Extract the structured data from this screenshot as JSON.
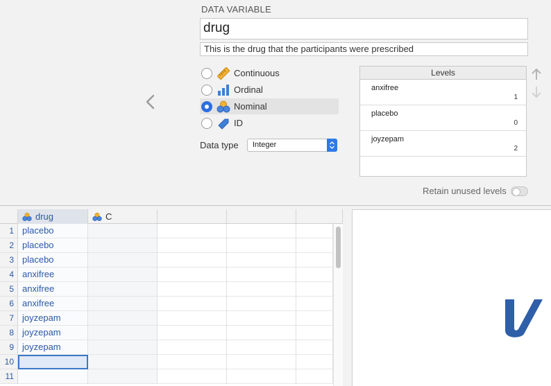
{
  "setup": {
    "panel_title": "DATA VARIABLE",
    "variable_name": "drug",
    "description": "This is the drug that the participants were prescribed",
    "measure_types": [
      {
        "label": "Continuous",
        "icon": "ruler-icon",
        "selected": false
      },
      {
        "label": "Ordinal",
        "icon": "bar-chart-icon",
        "selected": false
      },
      {
        "label": "Nominal",
        "icon": "nominal-circles-icon",
        "selected": true
      },
      {
        "label": "ID",
        "icon": "tag-icon",
        "selected": false
      }
    ],
    "data_type_label": "Data type",
    "data_type_value": "Integer",
    "levels_header": "Levels",
    "levels": [
      {
        "label": "anxifree",
        "value": "1"
      },
      {
        "label": "placebo",
        "value": "0"
      },
      {
        "label": "joyzepam",
        "value": "2"
      }
    ],
    "retain_unused_label": "Retain unused levels",
    "retain_unused_on": false
  },
  "sheet": {
    "columns": [
      "drug",
      "C",
      "",
      "",
      ""
    ],
    "row_numbers": [
      "1",
      "2",
      "3",
      "4",
      "5",
      "6",
      "7",
      "8",
      "9",
      "10",
      "11"
    ],
    "drug_values": [
      "placebo",
      "placebo",
      "placebo",
      "anxifree",
      "anxifree",
      "anxifree",
      "joyzepam",
      "joyzepam",
      "joyzepam",
      "",
      ""
    ],
    "selected_row": "10"
  },
  "colors": {
    "accent": "#2d6de0",
    "cell_text": "#2a5aa8",
    "logo_blue": "#2f5fa8"
  }
}
